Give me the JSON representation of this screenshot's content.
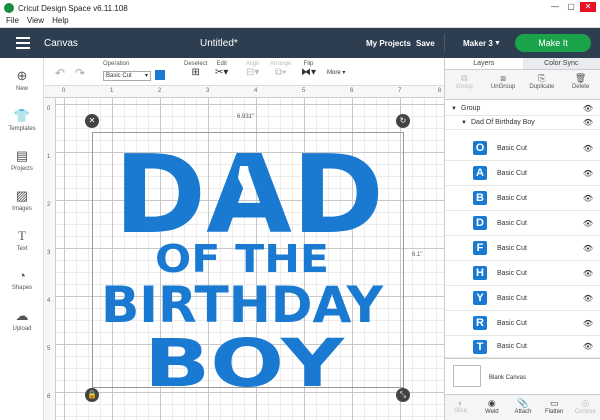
{
  "window": {
    "title": "Cricut Design Space  v6.11.108",
    "controls": [
      "—",
      "▢",
      "✕"
    ]
  },
  "menu": [
    "File",
    "View",
    "Help"
  ],
  "header": {
    "section": "Canvas",
    "doc_title": "Untitled*",
    "my_projects": "My Projects",
    "save": "Save",
    "machine": "Maker 3",
    "make_it": "Make It"
  },
  "toolbar": {
    "operation_label": "Operation",
    "operation_value": "Basic Cut",
    "operation_color": "#1a7ad1",
    "deselect": "Deselect",
    "edit": "Edit",
    "align": "Align",
    "arrange": "Arrange",
    "flip": "Flip",
    "more": "More ▾"
  },
  "leftbar": [
    {
      "label": "New",
      "icon": "plus-icon"
    },
    {
      "label": "Templates",
      "icon": "shirt-icon"
    },
    {
      "label": "Projects",
      "icon": "projects-icon"
    },
    {
      "label": "Images",
      "icon": "images-icon"
    },
    {
      "label": "Text",
      "icon": "text-icon"
    },
    {
      "label": "Shapes",
      "icon": "shapes-icon"
    },
    {
      "label": "Upload",
      "icon": "upload-icon"
    }
  ],
  "ruler": {
    "top": [
      "0",
      "1",
      "2",
      "3",
      "4",
      "5",
      "6",
      "7",
      "8"
    ],
    "left": [
      "0",
      "1",
      "2",
      "3",
      "4",
      "5",
      "6"
    ]
  },
  "canvas": {
    "width_label": "6.931\"",
    "height_label": "6.1\"",
    "art_lines": [
      "DAD",
      "OF THE",
      "BIRTHDAY",
      "BOY"
    ],
    "art_color": "#1a7ad1"
  },
  "panel": {
    "tabs": [
      "Layers",
      "Color Sync"
    ],
    "actions": [
      "Group",
      "UnGroup",
      "Duplicate",
      "Delete"
    ],
    "group_label": "Group",
    "subgroup_label": "Dad Of Birthday Boy",
    "layers": [
      {
        "thumb": "O",
        "name": "Basic Cut"
      },
      {
        "thumb": "A",
        "name": "Basic Cut"
      },
      {
        "thumb": "B",
        "name": "Basic Cut"
      },
      {
        "thumb": "D",
        "name": "Basic Cut"
      },
      {
        "thumb": "F",
        "name": "Basic Cut"
      },
      {
        "thumb": "H",
        "name": "Basic Cut"
      },
      {
        "thumb": "Y",
        "name": "Basic Cut"
      },
      {
        "thumb": "R",
        "name": "Basic Cut"
      },
      {
        "thumb": "T",
        "name": "Basic Cut"
      }
    ],
    "blank_canvas": "Blank Canvas",
    "footer": [
      "Slice",
      "Weld",
      "Attach",
      "Flatten",
      "Contour"
    ]
  }
}
